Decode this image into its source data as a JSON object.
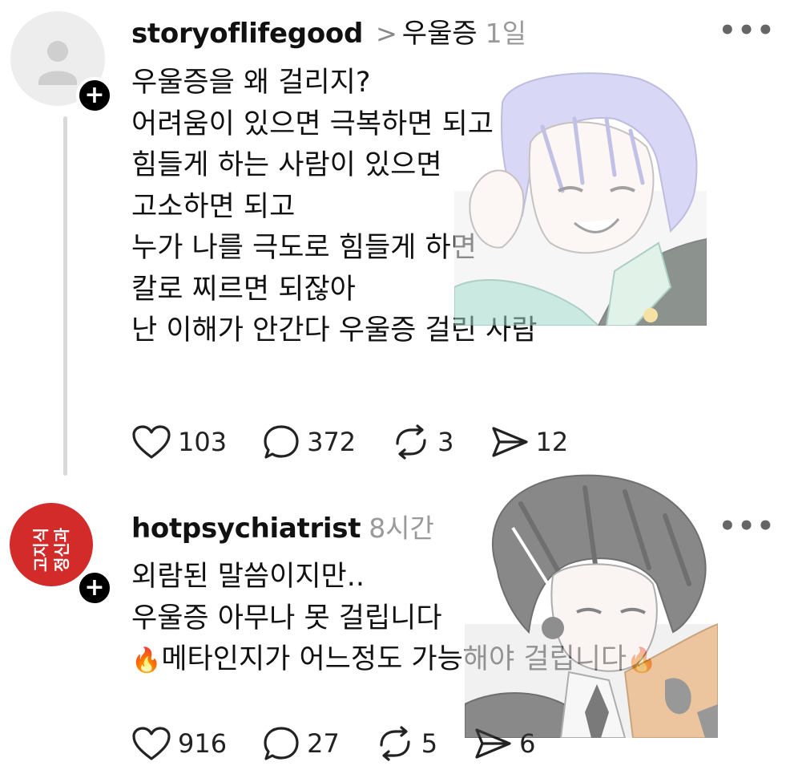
{
  "posts": [
    {
      "username": "storyoflifegood",
      "topic": "우울증",
      "time": "1일",
      "lines": [
        "우울증을 왜 걸리지?",
        "어려움이 있으면 극복하면 되고",
        "힘들게 하는 사람이 있으면",
        "고소하면 되고",
        "누가 나를 극도로 힘들게 하면",
        "칼로 찌르면 되잖아",
        "난 이해가 안간다 우울증 걸린 사람"
      ],
      "likes": "103",
      "replies": "372",
      "reposts": "3",
      "shares": "12"
    },
    {
      "username": "hotpsychiatrist",
      "time": "8시간",
      "avatar_text": "고지식정신과",
      "lines": [
        "외람된 말씀이지만..",
        "우울증 아무나 못 걸립니다",
        "메타인지가 어느정도 가능해야 걸립니다"
      ],
      "fire_emoji": "🔥",
      "likes": "916",
      "replies": "27",
      "reposts": "5",
      "shares": "6"
    }
  ],
  "icons": {
    "plus": "+",
    "separator": ">",
    "more": "•••"
  },
  "colors": {
    "avatar_red": "#d32a2a",
    "thread_line": "#d9d9d9",
    "time_gray": "#9a9a9a"
  }
}
